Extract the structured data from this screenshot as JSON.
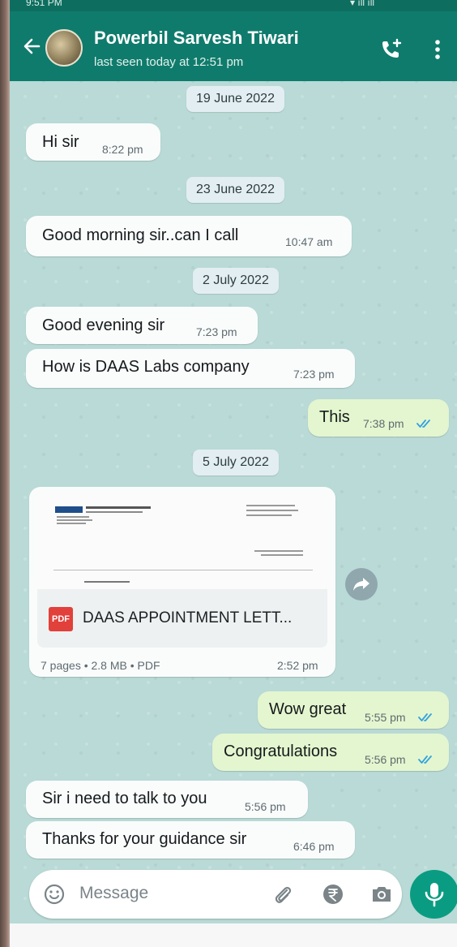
{
  "status_bar": {
    "left": "9:51 PM",
    "right": "▾ ıll ıll"
  },
  "header": {
    "contact_name": "Powerbil Sarvesh Tiwari",
    "last_seen": "last seen today at 12:51 pm"
  },
  "colors": {
    "header": "#0f7b6c",
    "chat_bg": "#b9dad6",
    "incoming": "#fafcfc",
    "outgoing": "#e4f6cf",
    "accent": "#0a9c82",
    "read_tick": "#34a2e0"
  },
  "messages": [
    {
      "kind": "date",
      "text": "19 June 2022"
    },
    {
      "kind": "in",
      "text": "Hi sir",
      "time": "8:22 pm"
    },
    {
      "kind": "date",
      "text": "23 June 2022"
    },
    {
      "kind": "in",
      "text": "Good morning sir..can I call",
      "time": "10:47 am"
    },
    {
      "kind": "date",
      "text": "2 July 2022"
    },
    {
      "kind": "in",
      "text": "Good evening sir",
      "time": "7:23 pm"
    },
    {
      "kind": "in",
      "text": "How is DAAS Labs company",
      "time": "7:23 pm"
    },
    {
      "kind": "out",
      "text": "This",
      "time": "7:38 pm",
      "status": "read"
    },
    {
      "kind": "date",
      "text": "5 July 2022"
    },
    {
      "kind": "out",
      "text": "Wow great",
      "time": "5:55 pm",
      "status": "read"
    },
    {
      "kind": "out",
      "text": "Congratulations",
      "time": "5:56 pm",
      "status": "read"
    },
    {
      "kind": "in",
      "text": "Sir i need to talk to you",
      "time": "5:56 pm"
    },
    {
      "kind": "in",
      "text": "Thanks for your guidance sir",
      "time": "6:46 pm"
    }
  ],
  "document": {
    "icon_label": "PDF",
    "name": "DAAS APPOINTMENT LETT...",
    "meta": "7 pages • 2.8 MB • PDF",
    "time": "2:52 pm"
  },
  "composer": {
    "placeholder": "Message"
  },
  "icons": [
    "back-arrow-icon",
    "add-call-icon",
    "more-vert-icon",
    "emoji-icon",
    "attach-icon",
    "rupee-icon",
    "camera-icon",
    "mic-icon",
    "forward-icon",
    "read-tick-icon",
    "pdf-icon"
  ]
}
